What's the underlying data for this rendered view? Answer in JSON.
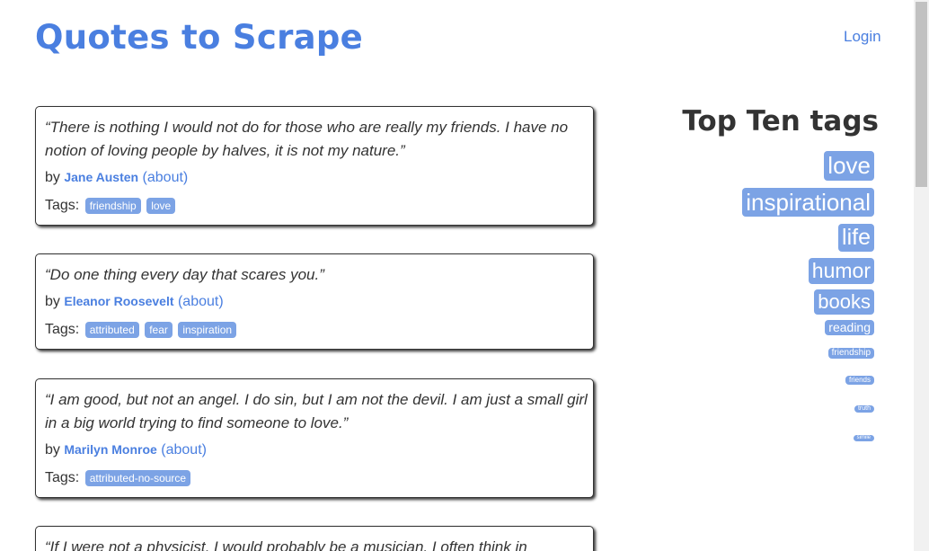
{
  "header": {
    "title": "Quotes to Scrape",
    "login_label": "Login"
  },
  "quotes": [
    {
      "text": "“There is nothing I would not do for those who are really my friends. I have no notion of loving people by halves, it is not my nature.”",
      "by_label": "by",
      "author": "Jane Austen",
      "about_label": "(about)",
      "tags_label": "Tags:",
      "tags": [
        "friendship",
        "love"
      ]
    },
    {
      "text": "“Do one thing every day that scares you.”",
      "by_label": "by",
      "author": "Eleanor Roosevelt",
      "about_label": "(about)",
      "tags_label": "Tags:",
      "tags": [
        "attributed",
        "fear",
        "inspiration"
      ]
    },
    {
      "text": "“I am good, but not an angel. I do sin, but I am not the devil. I am just a small girl in a big world trying to find someone to love.”",
      "by_label": "by",
      "author": "Marilyn Monroe",
      "about_label": "(about)",
      "tags_label": "Tags:",
      "tags": [
        "attributed-no-source"
      ]
    },
    {
      "text": "“If I were not a physicist, I would probably be a musician. I often think in"
    }
  ],
  "sidebar": {
    "title": "Top Ten tags",
    "tags": [
      {
        "label": "love"
      },
      {
        "label": "inspirational"
      },
      {
        "label": "life"
      },
      {
        "label": "humor"
      },
      {
        "label": "books"
      },
      {
        "label": "reading"
      },
      {
        "label": "friendship"
      },
      {
        "label": "friends"
      },
      {
        "label": "truth"
      },
      {
        "label": "simile"
      }
    ]
  },
  "colors": {
    "link": "#4a7fe0",
    "tag_bg": "#7ca3e5",
    "text": "#333333"
  }
}
